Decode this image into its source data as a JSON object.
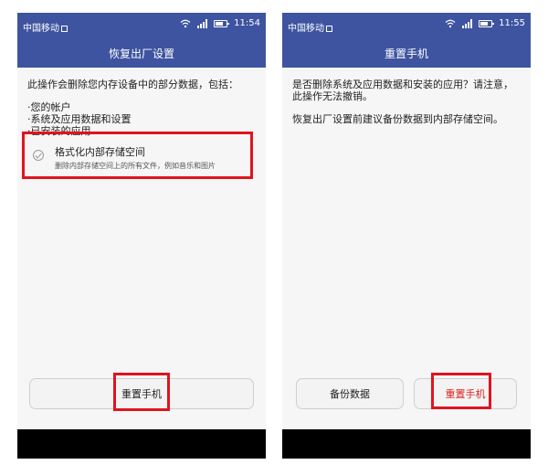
{
  "left_screen": {
    "status": {
      "carrier": "中国移动",
      "time": "11:54",
      "icons": [
        "sim-icon",
        "wifi-icon",
        "signal-icon",
        "battery-icon"
      ]
    },
    "title": "恢复出厂设置",
    "description": "此操作会删除您内存设备中的部分数据，包括：",
    "items": [
      "·您的帐户",
      "·系统及应用数据和设置",
      "·已安装的应用"
    ],
    "option": {
      "title": "格式化内部存储空间",
      "subtitle": "删除内部存储空间上的所有文件，例如音乐和图片",
      "icon": "check-circle-icon"
    },
    "button_label": "重置手机"
  },
  "right_screen": {
    "status": {
      "carrier": "中国移动",
      "time": "11:55",
      "icons": [
        "sim-icon",
        "wifi-icon",
        "signal-icon",
        "battery-icon"
      ]
    },
    "title": "重置手机",
    "question": "是否删除系统及应用数据和安装的应用？请注意，此操作无法撤销。",
    "note": "恢复出厂设置前建议备份数据到内部存储空间。",
    "backup_button_label": "备份数据",
    "reset_button_label": "重置手机"
  },
  "colors": {
    "header": "#3e54a0",
    "highlight_box": "#e0141e",
    "danger_text": "#e02020",
    "nav_bar": "#000000"
  }
}
